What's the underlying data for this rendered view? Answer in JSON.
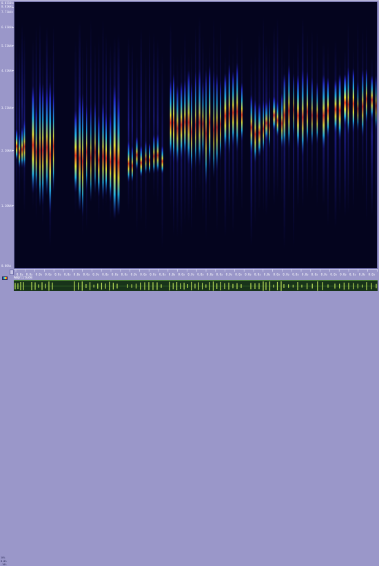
{
  "frequency_axis": {
    "labels": [
      "0.0110hz",
      "8.81kHz",
      "7.71kHz",
      "6.61kHz",
      "5.51kHz",
      "4.41kHz",
      "3.31kHz",
      "2.20kHz",
      "1.10kHz",
      "0.00hz"
    ]
  },
  "time_ruler": {
    "tick_label": "0.0s"
  },
  "amplitude_panel": {
    "title": "Amplitude",
    "side_labels": [
      "10%",
      "0.0%",
      "-10%"
    ]
  },
  "colors": {
    "background": "#9a97c9",
    "spectrogram_bg": "#04041e",
    "waveform": "#bde25a",
    "waveform_bg": "#18331a"
  },
  "icons": {
    "palette": "color-palette-icon"
  }
}
